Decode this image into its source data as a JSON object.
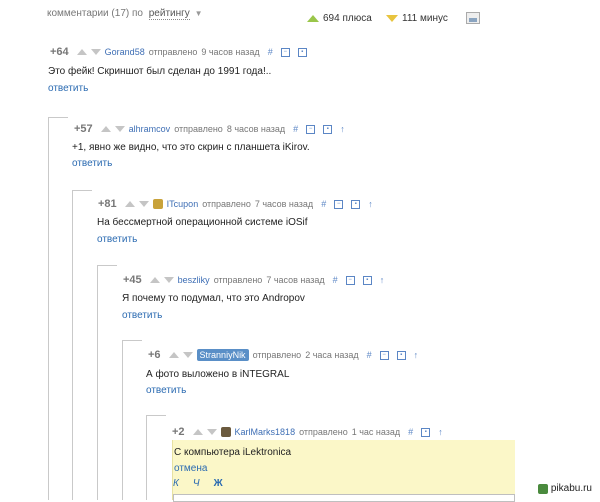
{
  "sort_bar": {
    "comments_label": "комментарии (17) по",
    "sort_value": "рейтингу",
    "plus_label": "694 плюса",
    "minus_label": "111 минус"
  },
  "comments": [
    {
      "score": "+64",
      "user": "Gorand58",
      "sent": "отправлено",
      "time": "9 часов назад",
      "text": "Это фейк! Скриншот был сделан до 1991 года!..",
      "reply": "ответить"
    },
    {
      "score": "+57",
      "user": "alhramcov",
      "sent": "отправлено",
      "time": "8 часов назад",
      "text": "+1, явно же видно, что это скрин с планшета iKirov.",
      "reply": "ответить"
    },
    {
      "score": "+81",
      "user": "ITcupon",
      "sent": "отправлено",
      "time": "7 часов назад",
      "text": "На бессмертной операционной системе iOSif",
      "reply": "ответить"
    },
    {
      "score": "+45",
      "user": "beszliky",
      "sent": "отправлено",
      "time": "7 часов назад",
      "text": "Я почему то подумал, что это Andropov",
      "reply": "ответить"
    },
    {
      "score": "+6",
      "user": "StranniyNik",
      "sent": "отправлено",
      "time": "2 часа назад",
      "text": "А фото выложено в iNTEGRAL",
      "reply": "ответить"
    },
    {
      "score": "+2",
      "user": "KarlMarks1818",
      "sent": "отправлено",
      "time": "1 час назад",
      "text": "С компьютера iLektronica",
      "reply": "отмена"
    }
  ],
  "editor": {
    "italic": "К",
    "underline": "Ч",
    "bold": "Ж"
  },
  "watermark": "pikabu.ru",
  "icons": {
    "hash": "#",
    "arrow_up": "↑"
  },
  "colors": {
    "link": "#2a6ab1",
    "plus_triangle": "#9ac64a",
    "minus_triangle": "#e8c43e",
    "highlight": "#fbf7c8",
    "user_badge": "#5a8fc7"
  }
}
